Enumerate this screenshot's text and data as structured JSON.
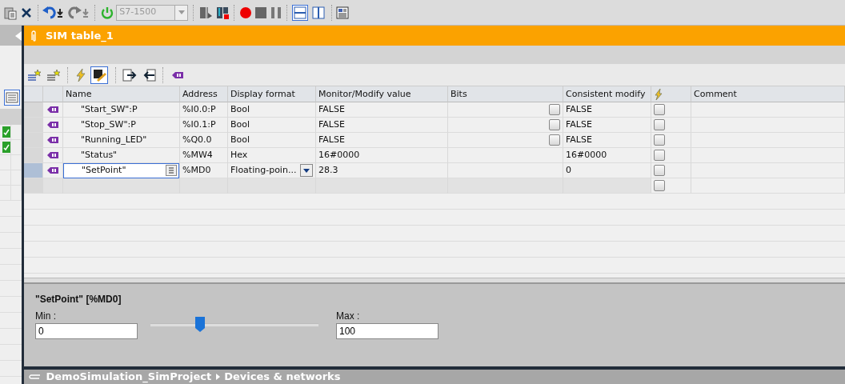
{
  "toolbar": {
    "cpu_select": {
      "value": "S7-1500",
      "disabled": true
    },
    "layout": [
      {
        "selected": true
      },
      {
        "selected": false
      }
    ]
  },
  "editor_tab": {
    "title": "SIM table_1"
  },
  "left_panel": {
    "rows": [
      {
        "checked": true
      },
      {
        "checked": true
      },
      {
        "checked": false
      },
      {
        "checked": false
      },
      {
        "checked": false
      }
    ]
  },
  "table_toolbar": {
    "view_toggle": {
      "selected": true
    },
    "mode_toggle": {
      "selected": true
    }
  },
  "table": {
    "columns": [
      "Name",
      "Address",
      "Display format",
      "Monitor/Modify value",
      "Bits",
      "Consistent modify",
      "Comment"
    ],
    "rows": [
      {
        "kind": "tag",
        "selected": false,
        "name": "\"Start_SW\":P",
        "address": "%I0.0:P",
        "format": "Bool",
        "monitor": "FALSE",
        "bits": {
          "checked": false
        },
        "consistent": "FALSE",
        "trigger": false
      },
      {
        "kind": "tag",
        "selected": false,
        "name": "\"Stop_SW\":P",
        "address": "%I0.1:P",
        "format": "Bool",
        "monitor": "FALSE",
        "bits": {
          "checked": false
        },
        "consistent": "FALSE",
        "trigger": false
      },
      {
        "kind": "tag",
        "selected": false,
        "name": "\"Running_LED\"",
        "address": "%Q0.0",
        "format": "Bool",
        "monitor": "FALSE",
        "bits": {
          "checked": false
        },
        "consistent": "FALSE",
        "trigger": false
      },
      {
        "kind": "tag",
        "selected": false,
        "name": "\"Status\"",
        "address": "%MW4",
        "format": "Hex",
        "monitor": "16#0000",
        "consistent": "16#0000",
        "trigger": false
      },
      {
        "kind": "tag",
        "selected": true,
        "name": "\"SetPoint\"",
        "address": "%MD0",
        "format": "Floating-poin...",
        "monitor": "28.3",
        "consistent": "0",
        "trigger": false
      },
      {
        "kind": "empty",
        "selected": false,
        "trigger": false
      }
    ]
  },
  "slider_panel": {
    "title": "\"SetPoint\" [%MD0]",
    "min_label": "Min :",
    "min": "0",
    "max_label": "Max :",
    "max": "100",
    "level": 0.283
  },
  "breadcrumb": [
    "DemoSimulation_SimProject",
    "Devices & networks"
  ]
}
